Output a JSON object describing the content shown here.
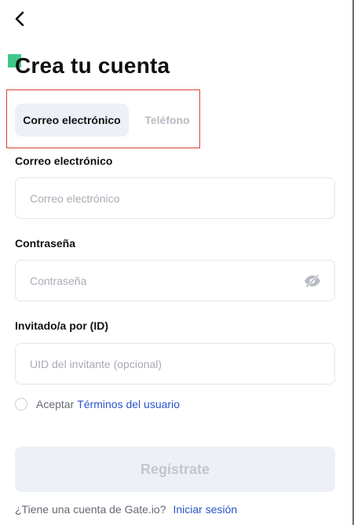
{
  "header": {
    "back_icon": "chevron-left-icon",
    "title": "Crea tu cuenta",
    "accent_color": "#3ec98b"
  },
  "tabs": {
    "email_label": "Correo electrónico",
    "phone_label": "Teléfono",
    "selected": "email",
    "highlight_color": "#d9413a"
  },
  "email": {
    "label": "Correo electrónico",
    "placeholder": "Correo electrónico",
    "value": ""
  },
  "password": {
    "label": "Contraseña",
    "placeholder": "Contraseña",
    "value": "",
    "toggle_icon": "eye-off-icon"
  },
  "referral": {
    "label": "Invitado/a por (ID)",
    "placeholder": "UID del invitante (opcional)",
    "value": ""
  },
  "terms": {
    "prefix": "Aceptar",
    "link_label": "Términos del usuario",
    "checked": false
  },
  "submit": {
    "label": "Regístrate",
    "enabled": false
  },
  "footer": {
    "text": "¿Tiene una cuenta de Gate.io?",
    "link_label": "Iniciar sesión",
    "link_color": "#2b55c9"
  }
}
